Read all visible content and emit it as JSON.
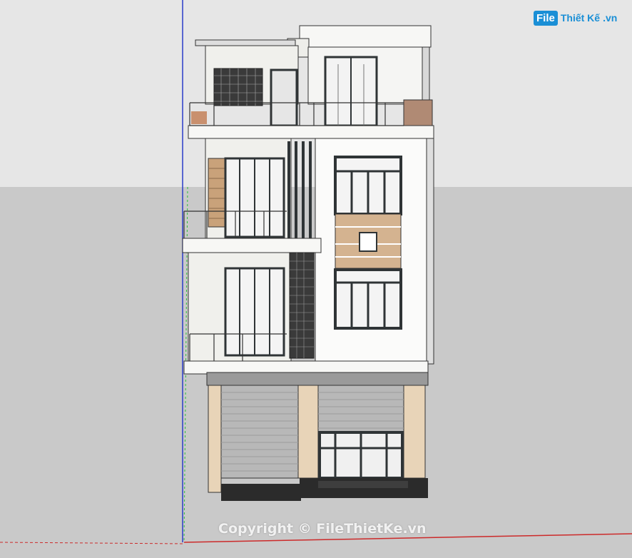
{
  "logo": {
    "box": "File",
    "text": "Thiết Kế",
    "suffix": ".vn"
  },
  "watermark": "Copyright © FileThietKe.vn",
  "colors": {
    "sky": "#e6e6e6",
    "ground": "#c9c9c9",
    "wall": "#f4f4f2",
    "frame": "#2f3436",
    "wood": "#c9a27a",
    "shutter": "#b8b8b8",
    "stone": "#e8d4b8",
    "axis_blue": "#2a3cc8",
    "axis_red": "#cc2a2a",
    "axis_green": "#2bbf3a",
    "brand": "#1a8fd6"
  }
}
